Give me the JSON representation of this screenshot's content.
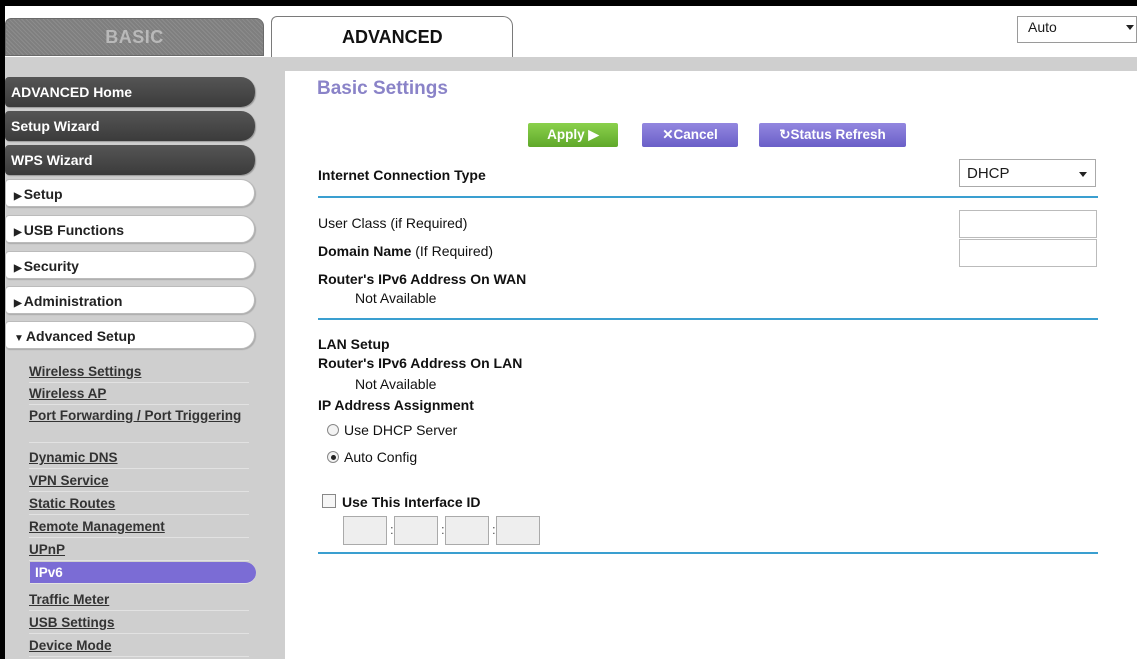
{
  "tabs": {
    "basic": "BASIC",
    "advanced": "ADVANCED"
  },
  "language": {
    "value": "Auto"
  },
  "sidebar": {
    "main": [
      "ADVANCED Home",
      "Setup Wizard",
      "WPS Wizard"
    ],
    "sections": [
      "Setup",
      "USB Functions",
      "Security",
      "Administration",
      "Advanced Setup"
    ],
    "subitems": [
      "Wireless Settings",
      "Wireless AP",
      "Port Forwarding / Port Triggering",
      "Dynamic DNS",
      "VPN Service",
      "Static Routes",
      "Remote Management",
      "UPnP",
      "IPv6",
      "Traffic Meter",
      "USB Settings",
      "Device Mode"
    ],
    "active": "IPv6"
  },
  "page": {
    "title": "Basic Settings",
    "buttons": {
      "apply": "Apply ▶",
      "cancel": "✕Cancel",
      "refresh": "↻Status Refresh"
    },
    "internet_connection_type": {
      "label": "Internet Connection Type",
      "value": "DHCP"
    },
    "user_class": {
      "label": "User Class (if Required)",
      "value": ""
    },
    "domain_name": {
      "label_bold": "Domain Name",
      "label_note": "(If Required)",
      "value": ""
    },
    "wan_ipv6": {
      "label": "Router's IPv6 Address On WAN",
      "value": "Not Available"
    },
    "lan_setup": {
      "label": "LAN Setup"
    },
    "lan_ipv6": {
      "label": "Router's IPv6 Address On LAN",
      "value": "Not Available"
    },
    "ip_assignment": {
      "label": "IP Address Assignment",
      "options": [
        "Use DHCP Server",
        "Auto Config"
      ],
      "selected": "Auto Config"
    },
    "interface_id": {
      "label": "Use This Interface ID",
      "checked": false,
      "fields": [
        "",
        "",
        "",
        ""
      ]
    }
  }
}
